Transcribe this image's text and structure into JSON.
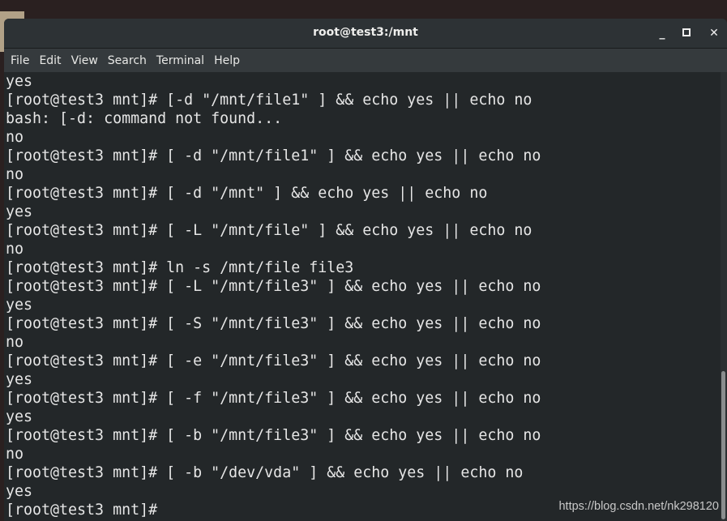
{
  "window": {
    "title": "root@test3:/mnt"
  },
  "menu": [
    "File",
    "Edit",
    "View",
    "Search",
    "Terminal",
    "Help"
  ],
  "terminal_lines": [
    "yes",
    "[root@test3 mnt]# [-d \"/mnt/file1\" ] && echo yes || echo no",
    "bash: [-d: command not found...",
    "no",
    "[root@test3 mnt]# [ -d \"/mnt/file1\" ] && echo yes || echo no",
    "no",
    "[root@test3 mnt]# [ -d \"/mnt\" ] && echo yes || echo no",
    "yes",
    "[root@test3 mnt]# [ -L \"/mnt/file\" ] && echo yes || echo no",
    "no",
    "[root@test3 mnt]# ln -s /mnt/file file3",
    "[root@test3 mnt]# [ -L \"/mnt/file3\" ] && echo yes || echo no",
    "yes",
    "[root@test3 mnt]# [ -S \"/mnt/file3\" ] && echo yes || echo no",
    "no",
    "[root@test3 mnt]# [ -e \"/mnt/file3\" ] && echo yes || echo no",
    "yes",
    "[root@test3 mnt]# [ -f \"/mnt/file3\" ] && echo yes || echo no",
    "yes",
    "[root@test3 mnt]# [ -b \"/mnt/file3\" ] && echo yes || echo no",
    "no",
    "[root@test3 mnt]# [ -b \"/dev/vda\" ] && echo yes || echo no",
    "yes",
    "[root@test3 mnt]# "
  ],
  "watermark": "https://blog.csdn.net/nk298120"
}
